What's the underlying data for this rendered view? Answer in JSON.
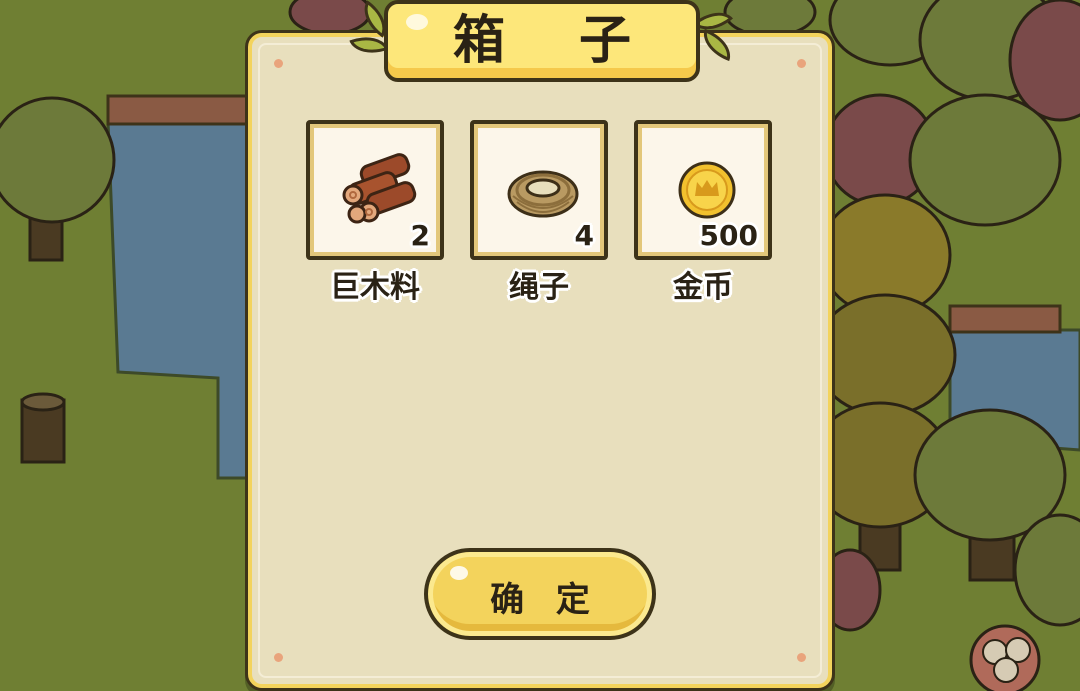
{
  "dialog": {
    "title": "箱 子",
    "confirm_label": "确 定"
  },
  "rewards": [
    {
      "icon": "wood-logs-icon",
      "name": "巨木料",
      "count": "2"
    },
    {
      "icon": "rope-coil-icon",
      "name": "绳子",
      "count": "4"
    },
    {
      "icon": "gold-coin-icon",
      "name": "金币",
      "count": "500"
    }
  ],
  "colors": {
    "panel": "#e8dfbd",
    "title_plate": "#fde77a",
    "button": "#f3d35c",
    "outline": "#3d3319",
    "grass": "#6f7f33",
    "water": "#5a7a92"
  }
}
